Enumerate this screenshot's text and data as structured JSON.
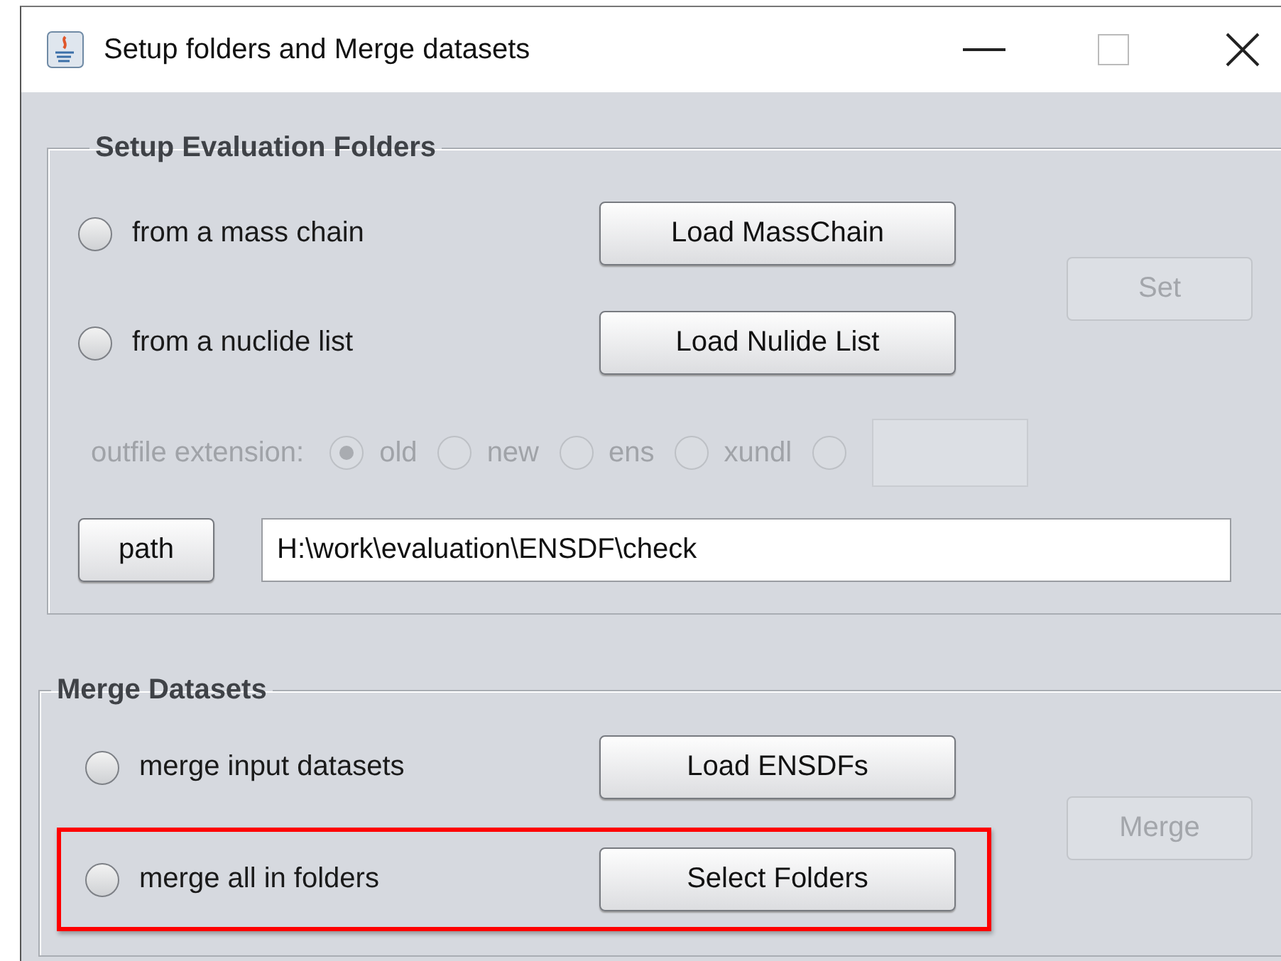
{
  "window": {
    "title": "Setup folders and Merge datasets"
  },
  "setup_group": {
    "title": "Setup Evaluation Folders",
    "options": [
      {
        "label": "from a mass chain",
        "selected": false,
        "button": "Load MassChain"
      },
      {
        "label": "from a nuclide list",
        "selected": false,
        "button": "Load Nulide List"
      }
    ],
    "set_button": {
      "label": "Set",
      "disabled": true
    },
    "outfile": {
      "label": "outfile extension:",
      "disabled": true,
      "choices": [
        {
          "label": "old",
          "selected": true
        },
        {
          "label": "new",
          "selected": false
        },
        {
          "label": "ens",
          "selected": false
        },
        {
          "label": "xundl",
          "selected": false
        },
        {
          "selected": false
        }
      ]
    },
    "path": {
      "button": "path",
      "value": "H:\\work\\evaluation\\ENSDF\\check"
    }
  },
  "merge_group": {
    "title": "Merge Datasets",
    "options": [
      {
        "label": "merge input datasets",
        "selected": false,
        "button": "Load ENSDFs",
        "highlighted": false
      },
      {
        "label": "merge all in folders",
        "selected": false,
        "button": "Select Folders",
        "highlighted": true
      }
    ],
    "merge_button": {
      "label": "Merge",
      "disabled": true
    }
  }
}
